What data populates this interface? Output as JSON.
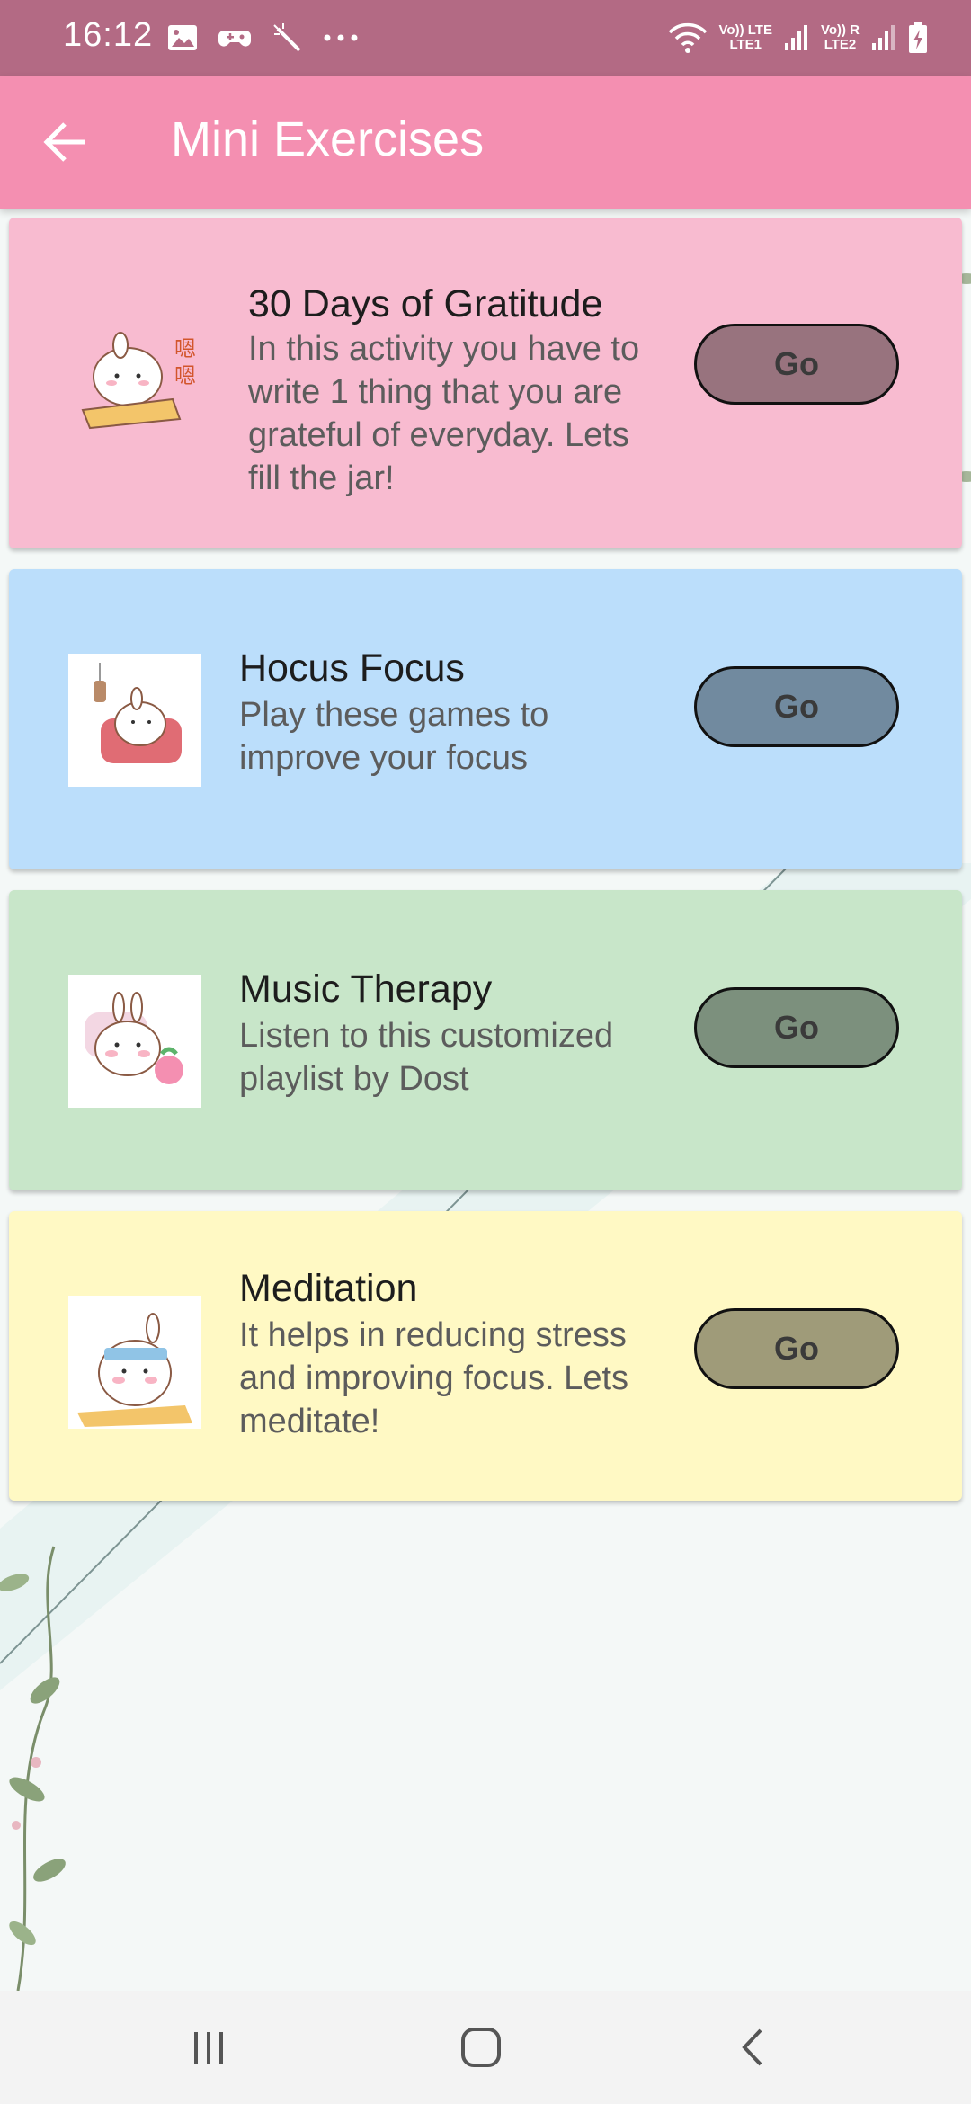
{
  "status_bar": {
    "time": "16:12",
    "sim1_label_top": "Vo)) LTE",
    "sim1_label_bottom": "LTE1",
    "sim2_label_top": "Vo)) R",
    "sim2_label_bottom": "LTE2",
    "left_icons": [
      "gallery-icon",
      "game-controller-icon",
      "magic-wand-icon",
      "more-dots-icon"
    ],
    "right_icons": [
      "wifi-icon",
      "signal-icon",
      "battery-charging-icon"
    ]
  },
  "app_bar": {
    "title": "Mini Exercises",
    "back_icon": "arrow-left-icon"
  },
  "cards": [
    {
      "title": "30 Days of Gratitude",
      "description": "In this activity you have to write 1 thing that you are grateful of everyday. Lets fill the jar!",
      "button": "Go",
      "bg_color": "#f8bbd0",
      "button_color": "#98737e",
      "icon": "bunny-writing-icon"
    },
    {
      "title": "Hocus Focus",
      "description": "Play these games to improve your focus",
      "button": "Go",
      "bg_color": "#bbdefb",
      "button_color": "#718a9f",
      "icon": "bunny-armchair-icon"
    },
    {
      "title": "Music Therapy",
      "description": "Listen to this customized playlist by Dost",
      "button": "Go",
      "bg_color": "#c8e6c9",
      "button_color": "#7c907d",
      "icon": "bunny-music-icon"
    },
    {
      "title": "Meditation",
      "description": "It helps in reducing stress and improving focus. Lets meditate!",
      "button": "Go",
      "bg_color": "#fff9c4",
      "button_color": "#9f9b79",
      "icon": "bunny-meditating-icon"
    }
  ],
  "nav_bar": {
    "items": [
      "recent-apps-icon",
      "home-icon",
      "back-icon"
    ]
  }
}
